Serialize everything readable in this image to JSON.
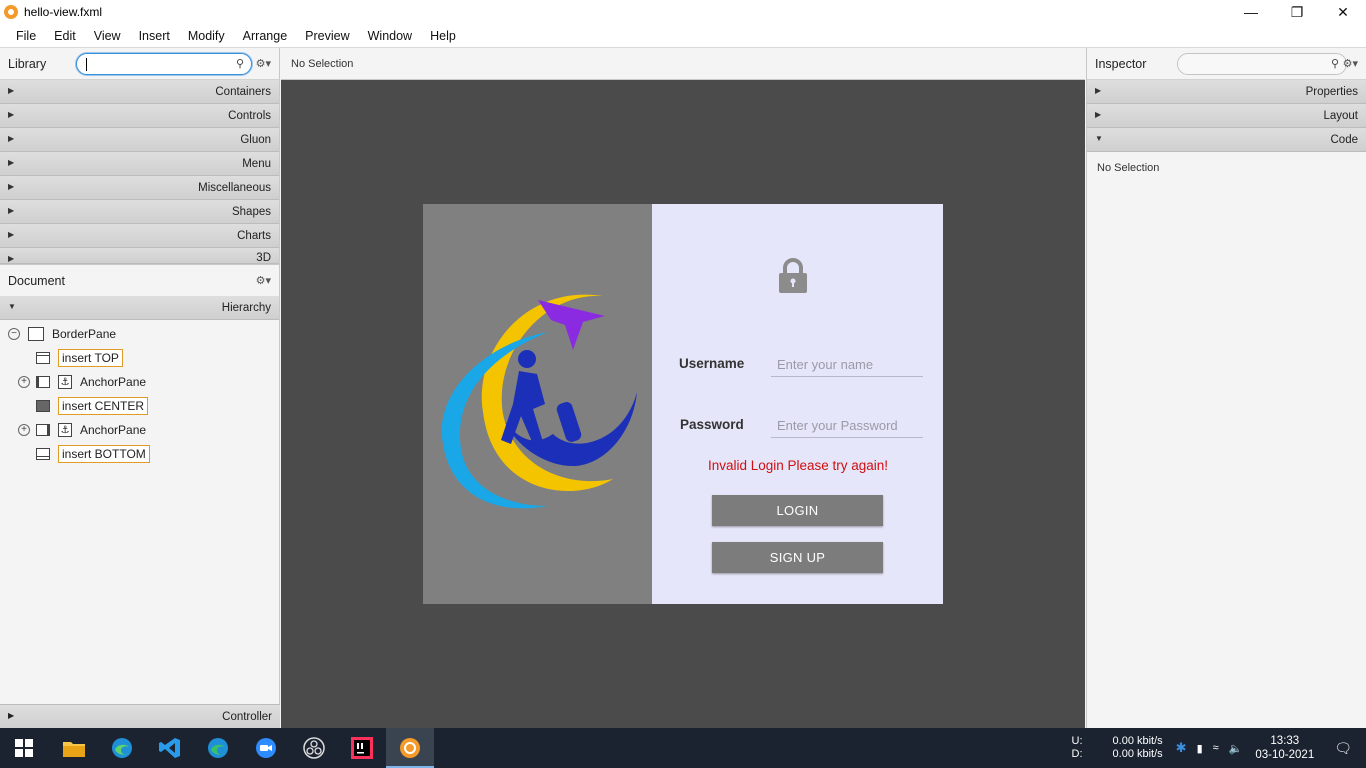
{
  "window": {
    "title": "hello-view.fxml",
    "minimize": "—",
    "restore": "❐",
    "close": "✕"
  },
  "menu": [
    "File",
    "Edit",
    "View",
    "Insert",
    "Modify",
    "Arrange",
    "Preview",
    "Window",
    "Help"
  ],
  "library": {
    "title": "Library",
    "search_value": "",
    "sections": [
      "Containers",
      "Controls",
      "Gluon",
      "Menu",
      "Miscellaneous",
      "Shapes",
      "Charts",
      "3D"
    ]
  },
  "document": {
    "title": "Document",
    "hierarchy_label": "Hierarchy",
    "tree": [
      {
        "label": "BorderPane"
      },
      {
        "label": "insert TOP"
      },
      {
        "label": "AnchorPane"
      },
      {
        "label": "insert CENTER"
      },
      {
        "label": "AnchorPane"
      },
      {
        "label": "insert BOTTOM"
      }
    ],
    "controller_label": "Controller"
  },
  "content": {
    "selection_label": "No Selection"
  },
  "login": {
    "username_label": "Username",
    "username_placeholder": "Enter your name",
    "password_label": "Password",
    "password_placeholder": "Enter your Password",
    "error_message": "Invalid Login Please try again!",
    "login_button": "LOGIN",
    "signup_button": "SIGN UP",
    "error_color": "#d01010",
    "left_panel_color": "#808080",
    "right_panel_color": "#e6e6fa"
  },
  "inspector": {
    "title": "Inspector",
    "sections": [
      "Properties",
      "Layout",
      "Code"
    ],
    "selection_label": "No Selection"
  },
  "taskbar": {
    "apps": [
      "windows-start-icon",
      "file-explorer-icon",
      "edge-icon",
      "vscode-icon",
      "edge-dev-icon",
      "zoom-icon",
      "obs-icon",
      "intellij-icon",
      "scene-builder-icon"
    ],
    "net_upload_label": "U:",
    "net_download_label": "D:",
    "net_upload": "0.00 kbit/s",
    "net_download": "0.00 kbit/s",
    "time": "13:33",
    "date": "03-10-2021"
  }
}
